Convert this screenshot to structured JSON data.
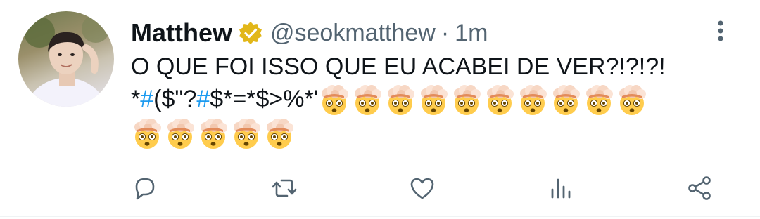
{
  "tweet": {
    "author": {
      "display_name": "Matthew",
      "handle": "@seokmatthew",
      "separator": "·",
      "time": "1m",
      "verified": true,
      "avatar_icon": "profile-photo"
    },
    "text": {
      "line1": "O QUE FOI ISSO QUE EU ACABEI DE VER?!?!?!",
      "line2_segments": [
        "*",
        "#",
        "($\"?",
        "#",
        "$*=*$>%*'"
      ],
      "emoji_icon": "exploding-head-emoji",
      "emoji_count_line2": 10,
      "emoji_count_line3": 5
    },
    "actions": [
      "reply-icon",
      "retweet-icon",
      "like-icon",
      "analytics-icon",
      "share-icon"
    ],
    "colors": {
      "text": "#0f1419",
      "secondary": "#536471",
      "hashtag": "#1d9bf0",
      "verified_badge": "#e2b719"
    }
  }
}
